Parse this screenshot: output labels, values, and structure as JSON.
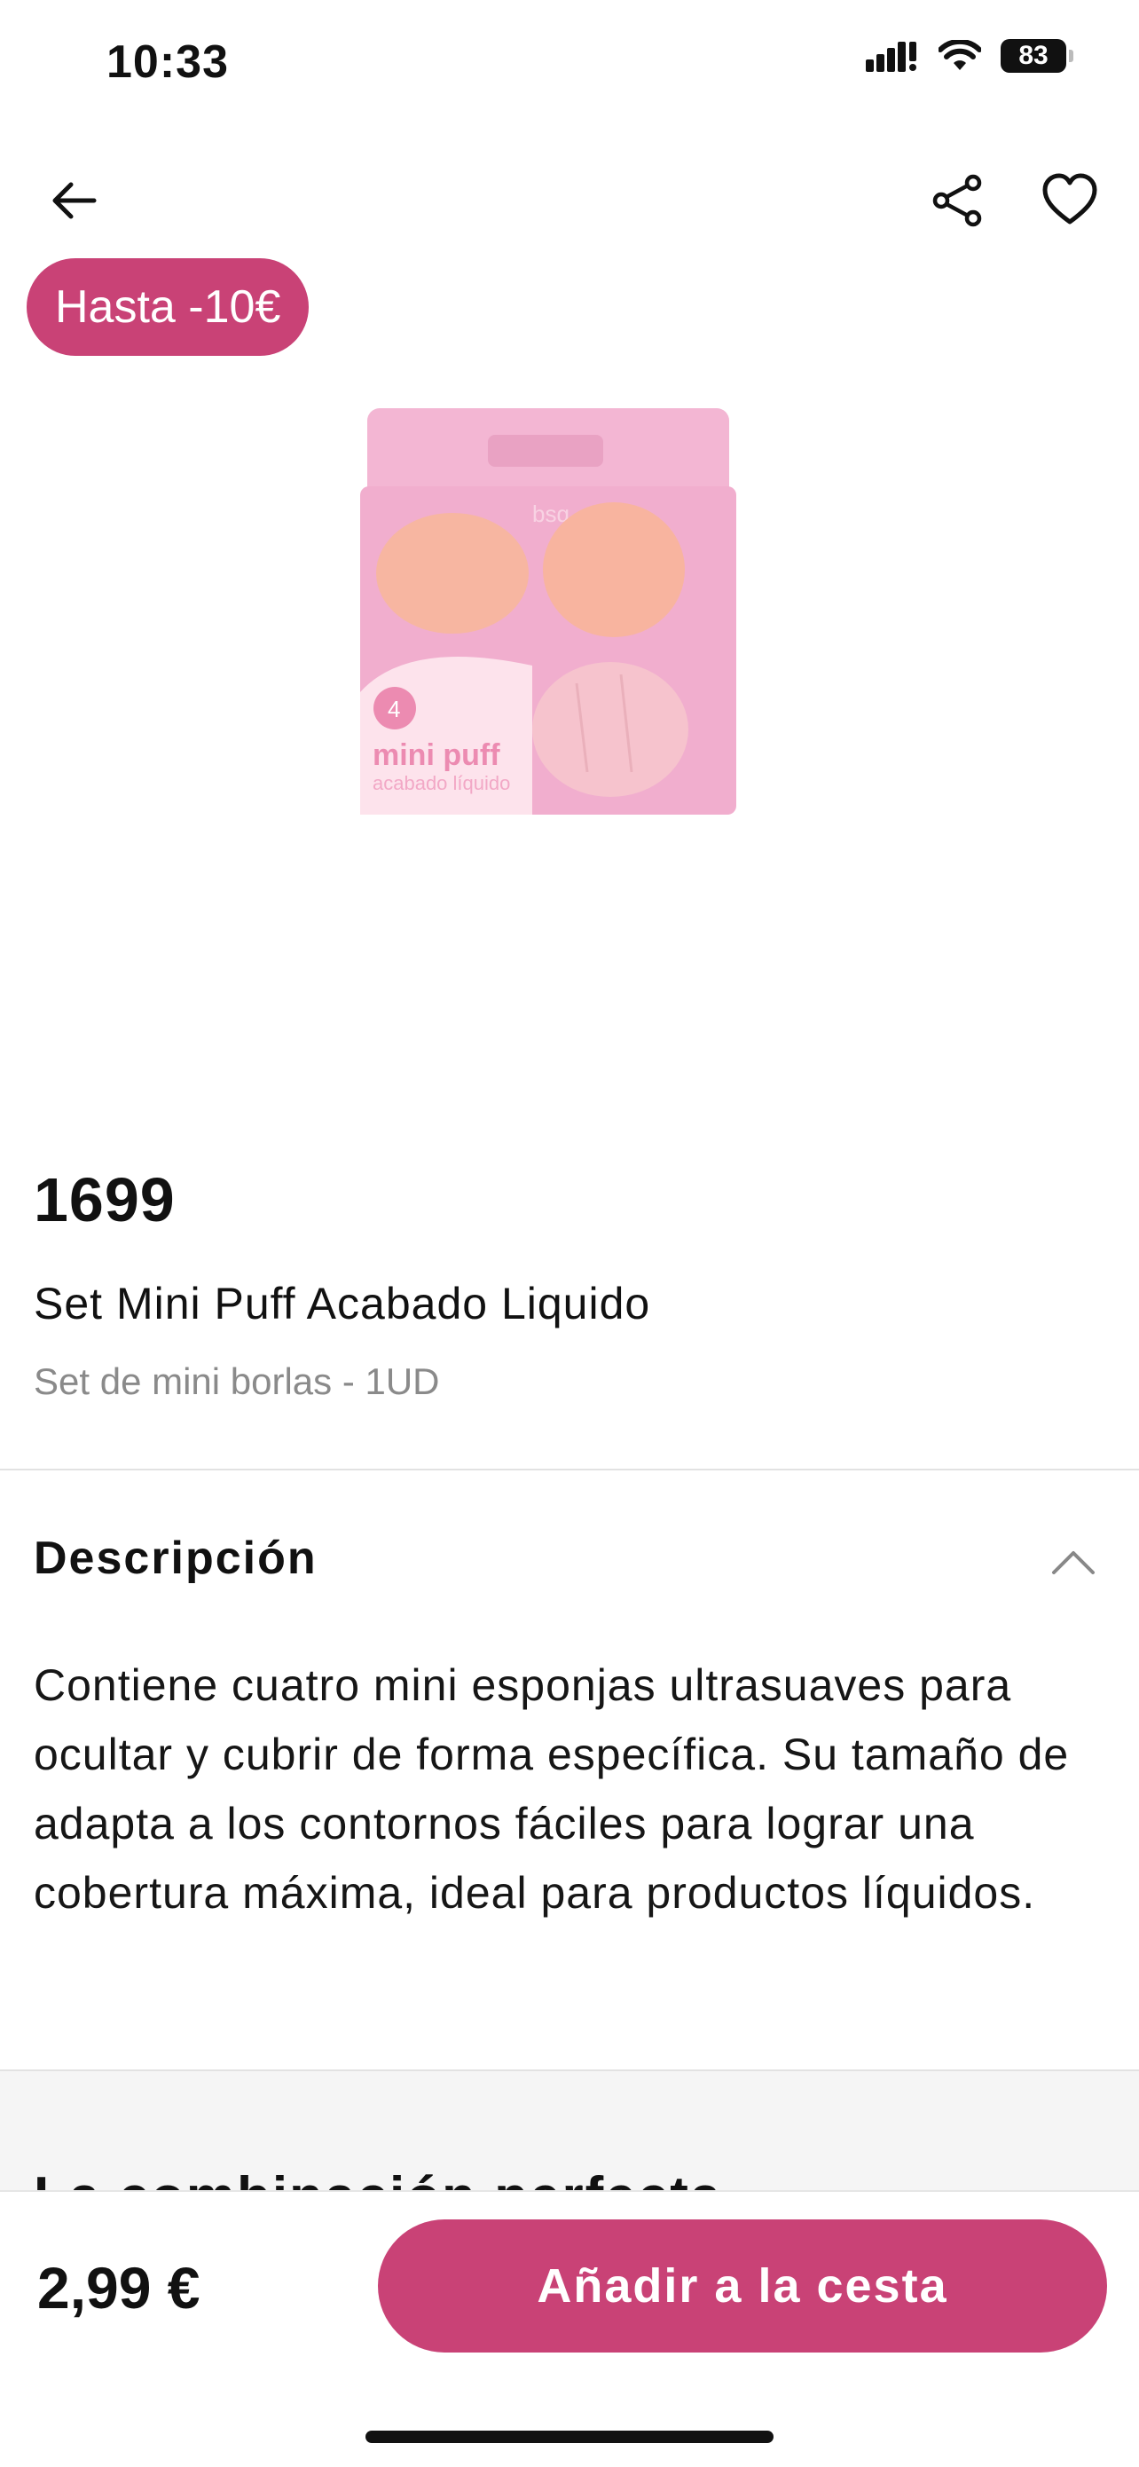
{
  "status_bar": {
    "time": "10:33",
    "battery": "83"
  },
  "badge": {
    "label": "Hasta -10€"
  },
  "product": {
    "price_raw": "1699",
    "name": "Set Mini Puff Acabado Liquido",
    "subtitle": "Set de mini borlas - 1UD",
    "package_logo": "bsq",
    "package_count": "4",
    "package_name": "mini puff",
    "package_sub": "acabado líquido"
  },
  "description": {
    "heading": "Descripción",
    "text": "Contiene cuatro mini esponjas ultrasuaves para ocultar y cubrir de forma específica. Su tamaño de adapta a los contornos fáciles para lograr una cobertura máxima, ideal para productos líquidos."
  },
  "combination": {
    "title": "La combinación perfecta"
  },
  "bottom_bar": {
    "price": "2,99 €",
    "cta_label": "Añadir a la cesta"
  },
  "colors": {
    "accent": "#c94276",
    "text": "#111111",
    "muted": "#8a8a8a"
  },
  "icons": [
    "back-arrow-icon",
    "share-icon",
    "heart-icon",
    "chevron-up-icon",
    "signal-icon",
    "wifi-icon",
    "battery-icon"
  ]
}
